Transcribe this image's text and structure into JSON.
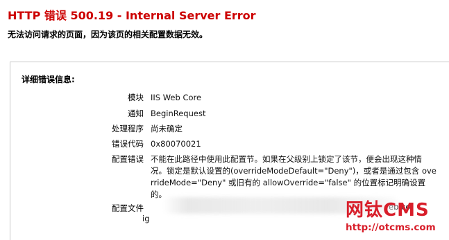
{
  "header": {
    "title": "HTTP 错误 500.19 - Internal Server Error",
    "subtitle": "无法访问请求的页面，因为该页的相关配置数据无效。"
  },
  "detail": {
    "heading": "详细错误信息:",
    "rows": [
      {
        "label": "模块",
        "value": "IIS Web Core"
      },
      {
        "label": "通知",
        "value": "BeginRequest"
      },
      {
        "label": "处理程序",
        "value": "尚未确定"
      },
      {
        "label": "错误代码",
        "value": "0x80070021"
      },
      {
        "label": "配置错误",
        "value_lines": [
          "不能在此路径中使用此配置节。如果在父级别上锁定了该节，便会出现这种情",
          "况。锁定是默认设置的(overrideModeDefault=\"Deny\")，或者是通过包含 ove",
          "rrideMode=\"Deny\" 或旧有的 allowOverride=\"false\" 的位置标记明确设置",
          "的。"
        ]
      },
      {
        "label": "配置文件",
        "value_visible_fragment_right": "eb.co",
        "value_line2": "ig"
      }
    ]
  },
  "watermark": {
    "brand": "网钛CMS",
    "url": "http://otcms.com"
  }
}
